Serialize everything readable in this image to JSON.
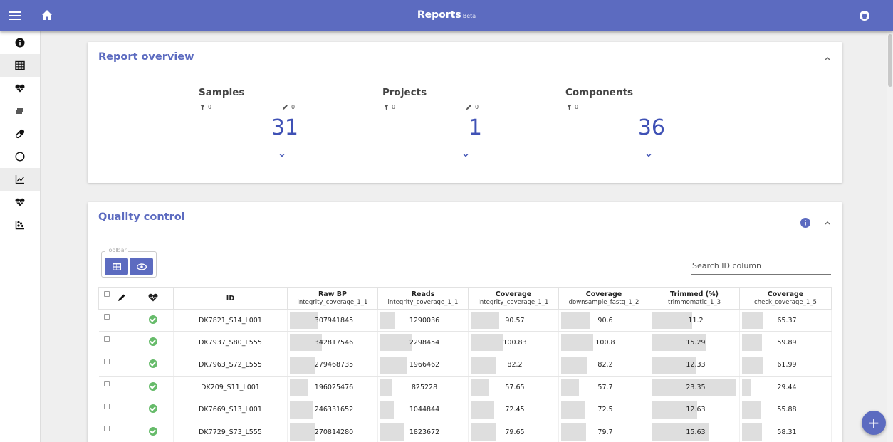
{
  "app": {
    "title": "Reports",
    "title_badge": "Beta"
  },
  "icons": {
    "menu": "menu-icon",
    "home": "home-icon",
    "github": "github-icon"
  },
  "colors": {
    "primary": "#5c6bc0",
    "accent_number": "#3f51b5",
    "ok": "#66bb6a"
  },
  "sidebar": {
    "items": [
      {
        "icon": "info-icon",
        "active": false
      },
      {
        "icon": "table-icon",
        "active": true
      },
      {
        "icon": "heart-pulse-icon",
        "active": false
      },
      {
        "icon": "list-icon",
        "active": false
      },
      {
        "icon": "pill-icon",
        "active": false
      },
      {
        "icon": "circle-icon",
        "active": false
      },
      {
        "icon": "line-chart-icon",
        "active": true
      },
      {
        "icon": "heart-pulse-icon",
        "active": false
      },
      {
        "icon": "scatter-icon",
        "active": false
      }
    ]
  },
  "overview": {
    "title": "Report overview",
    "stats": [
      {
        "name": "Samples",
        "filter": "0",
        "edit": "0",
        "value": "31",
        "has_edit": true
      },
      {
        "name": "Projects",
        "filter": "0",
        "edit": "0",
        "value": "1",
        "has_edit": true
      },
      {
        "name": "Components",
        "filter": "0",
        "edit": "",
        "value": "36",
        "has_edit": false
      }
    ]
  },
  "qc": {
    "title": "Quality control",
    "toolbar_label": "Toolbar",
    "search_placeholder": "Search ID column",
    "columns": [
      {
        "title": "ID",
        "sub": ""
      },
      {
        "title": "Raw BP",
        "sub": "integrity_coverage_1_1"
      },
      {
        "title": "Reads",
        "sub": "integrity_coverage_1_1"
      },
      {
        "title": "Coverage",
        "sub": "integrity_coverage_1_1"
      },
      {
        "title": "Coverage",
        "sub": "downsample_fastq_1_2"
      },
      {
        "title": "Trimmed (%)",
        "sub": "trimmomatic_1_3"
      },
      {
        "title": "Coverage",
        "sub": "check_coverage_1_5"
      }
    ],
    "rows": [
      {
        "id": "DK7821_S14_L001",
        "cells": [
          {
            "value": "307941845",
            "fill": 0.33
          },
          {
            "value": "1290036",
            "fill": 0.17
          },
          {
            "value": "90.57",
            "fill": 0.33
          },
          {
            "value": "90.6",
            "fill": 0.33
          },
          {
            "value": "11.2",
            "fill": 0.47
          },
          {
            "value": "65.37",
            "fill": 0.25
          }
        ]
      },
      {
        "id": "DK7937_S80_L555",
        "cells": [
          {
            "value": "342817546",
            "fill": 0.37
          },
          {
            "value": "2298454",
            "fill": 0.37
          },
          {
            "value": "100.83",
            "fill": 0.37
          },
          {
            "value": "100.8",
            "fill": 0.37
          },
          {
            "value": "15.29",
            "fill": 0.64
          },
          {
            "value": "59.89",
            "fill": 0.23
          }
        ]
      },
      {
        "id": "DK7963_S72_L555",
        "cells": [
          {
            "value": "279468735",
            "fill": 0.3
          },
          {
            "value": "1966462",
            "fill": 0.31
          },
          {
            "value": "82.2",
            "fill": 0.3
          },
          {
            "value": "82.2",
            "fill": 0.3
          },
          {
            "value": "12.33",
            "fill": 0.52
          },
          {
            "value": "61.99",
            "fill": 0.24
          }
        ]
      },
      {
        "id": "DK209_S11_L001",
        "cells": [
          {
            "value": "196025476",
            "fill": 0.21
          },
          {
            "value": "825228",
            "fill": 0.13
          },
          {
            "value": "57.65",
            "fill": 0.21
          },
          {
            "value": "57.7",
            "fill": 0.21
          },
          {
            "value": "23.35",
            "fill": 0.98
          },
          {
            "value": "29.44",
            "fill": 0.11
          }
        ]
      },
      {
        "id": "DK7669_S13_L001",
        "cells": [
          {
            "value": "246331652",
            "fill": 0.27
          },
          {
            "value": "1044844",
            "fill": 0.16
          },
          {
            "value": "72.45",
            "fill": 0.27
          },
          {
            "value": "72.5",
            "fill": 0.27
          },
          {
            "value": "12.63",
            "fill": 0.53
          },
          {
            "value": "55.88",
            "fill": 0.22
          }
        ]
      },
      {
        "id": "DK7729_S73_L555",
        "cells": [
          {
            "value": "270814280",
            "fill": 0.29
          },
          {
            "value": "1823672",
            "fill": 0.28
          },
          {
            "value": "79.65",
            "fill": 0.29
          },
          {
            "value": "79.7",
            "fill": 0.29
          },
          {
            "value": "15.63",
            "fill": 0.66
          },
          {
            "value": "58.31",
            "fill": 0.23
          }
        ]
      }
    ]
  },
  "fab_label": "+"
}
